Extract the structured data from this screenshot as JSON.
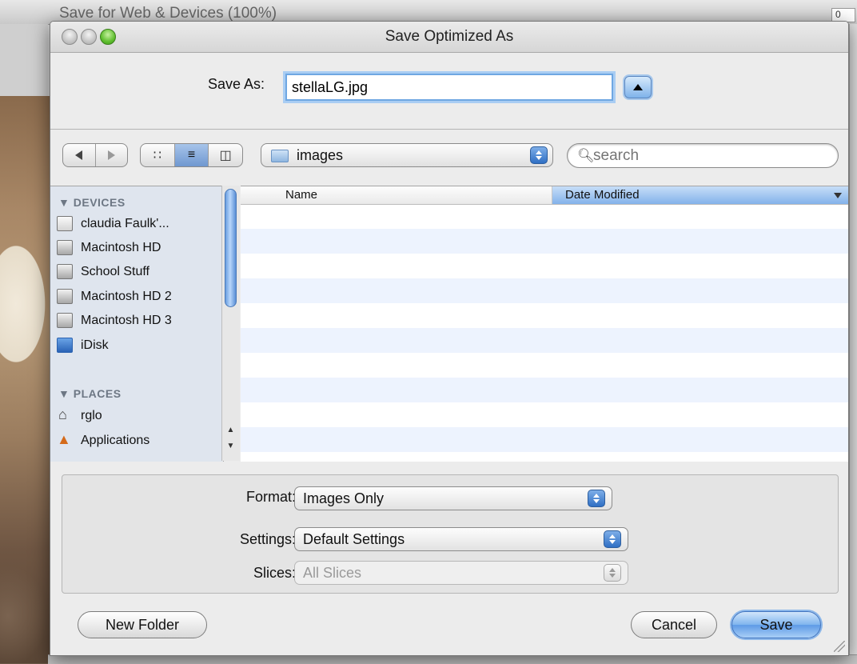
{
  "background": {
    "window_title": "Save for Web & Devices (100%)",
    "corner_field": "0"
  },
  "dialog": {
    "title": "Save Optimized As",
    "save_as_label": "Save As:",
    "save_as_value": "stellaLG.jpg",
    "location": "images",
    "search_placeholder": "search",
    "sidebar": {
      "devices_heading": "DEVICES",
      "devices": [
        {
          "label": "claudia Faulk'...",
          "icon": "hard-disk-icon"
        },
        {
          "label": "Macintosh HD",
          "icon": "hard-disk-icon"
        },
        {
          "label": "School Stuff",
          "icon": "hard-disk-icon"
        },
        {
          "label": "Macintosh HD 2",
          "icon": "hard-disk-icon"
        },
        {
          "label": "Macintosh HD 3",
          "icon": "hard-disk-icon"
        },
        {
          "label": "iDisk",
          "icon": "idisk-icon"
        }
      ],
      "places_heading": "PLACES",
      "places": [
        {
          "label": "rglo",
          "icon": "home-icon"
        },
        {
          "label": "Applications",
          "icon": "applications-icon"
        }
      ]
    },
    "columns": {
      "name": "Name",
      "date_modified": "Date Modified"
    },
    "options": {
      "format_label": "Format:",
      "format_value": "Images Only",
      "settings_label": "Settings:",
      "settings_value": "Default Settings",
      "slices_label": "Slices:",
      "slices_value": "All Slices"
    },
    "buttons": {
      "new_folder": "New Folder",
      "cancel": "Cancel",
      "save": "Save"
    },
    "accent_color": "#6fa7e2"
  }
}
